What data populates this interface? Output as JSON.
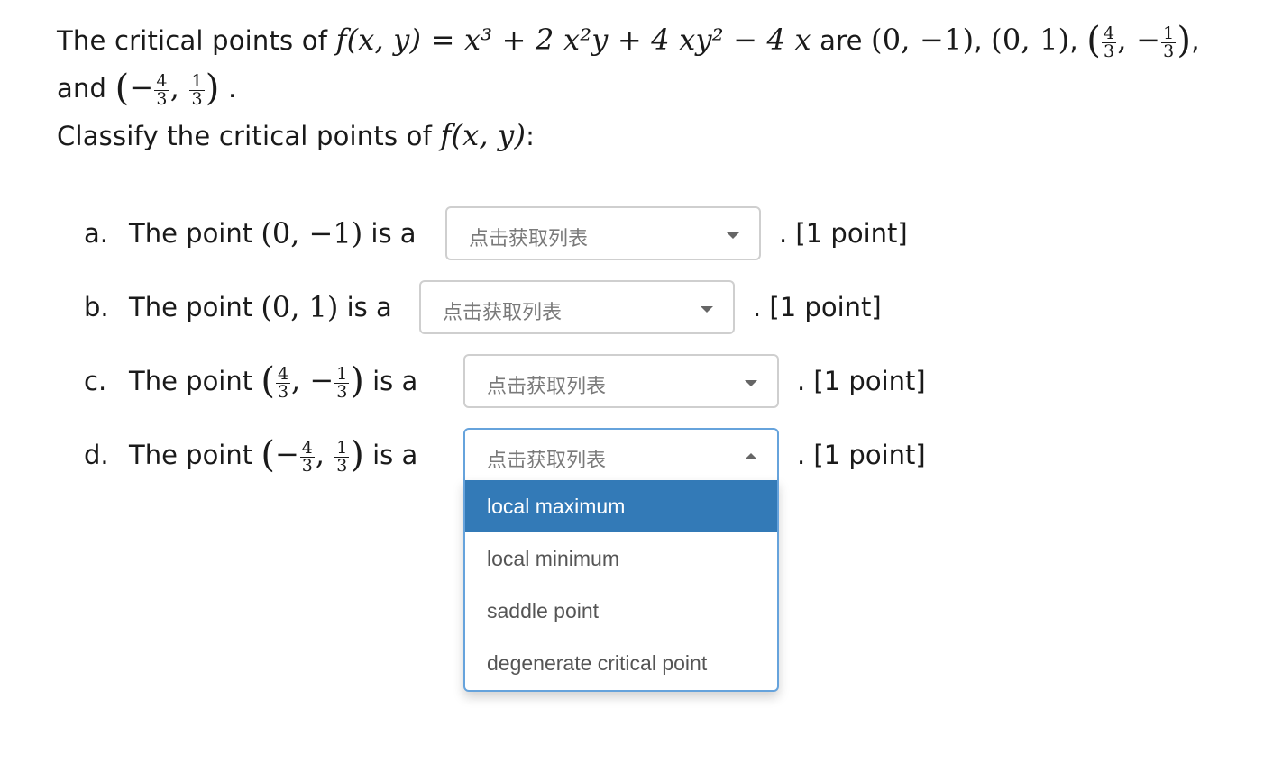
{
  "intro": {
    "t1": "The critical points of ",
    "fn": "f(x, y)",
    "eq": " = x³ + 2 x²y + 4 xy² − 4 x",
    "are": " are ",
    "p1": "(0, −1)",
    "p2": "(0, 1)",
    "p3_num1": "4",
    "p3_den1": "3",
    "p3_num2": "1",
    "p3_den2": "3",
    "and": "and ",
    "p4_num1": "4",
    "p4_den1": "3",
    "p4_num2": "1",
    "p4_den2": "3",
    "classify": "Classify the critical points of ",
    "fn2": "f(x, y)"
  },
  "questions": [
    {
      "letter": "a.",
      "text": "The point",
      "point": "(0, −1)",
      "is_a": "is a",
      "placeholder": "点击获取列表",
      "suffix": ". [1 point]"
    },
    {
      "letter": "b.",
      "text": "The point",
      "point": "(0, 1)",
      "is_a": "is a",
      "placeholder": "点击获取列表",
      "suffix": ". [1 point]"
    },
    {
      "letter": "c.",
      "text": "The point",
      "is_a": "is a",
      "num1": "4",
      "den1": "3",
      "num2": "1",
      "den2": "3",
      "placeholder": "点击获取列表",
      "suffix": ". [1 point]"
    },
    {
      "letter": "d.",
      "text": "The point",
      "is_a": "is a",
      "num1": "4",
      "den1": "3",
      "num2": "1",
      "den2": "3",
      "placeholder": "点击获取列表",
      "suffix": ". [1 point]"
    }
  ],
  "dropdown": {
    "options": [
      "local maximum",
      "local minimum",
      "saddle point",
      "degenerate critical point"
    ],
    "highlighted": "local maximum"
  },
  "colors": {
    "highlight": "#337ab7",
    "focus_border": "#66a3dc"
  }
}
